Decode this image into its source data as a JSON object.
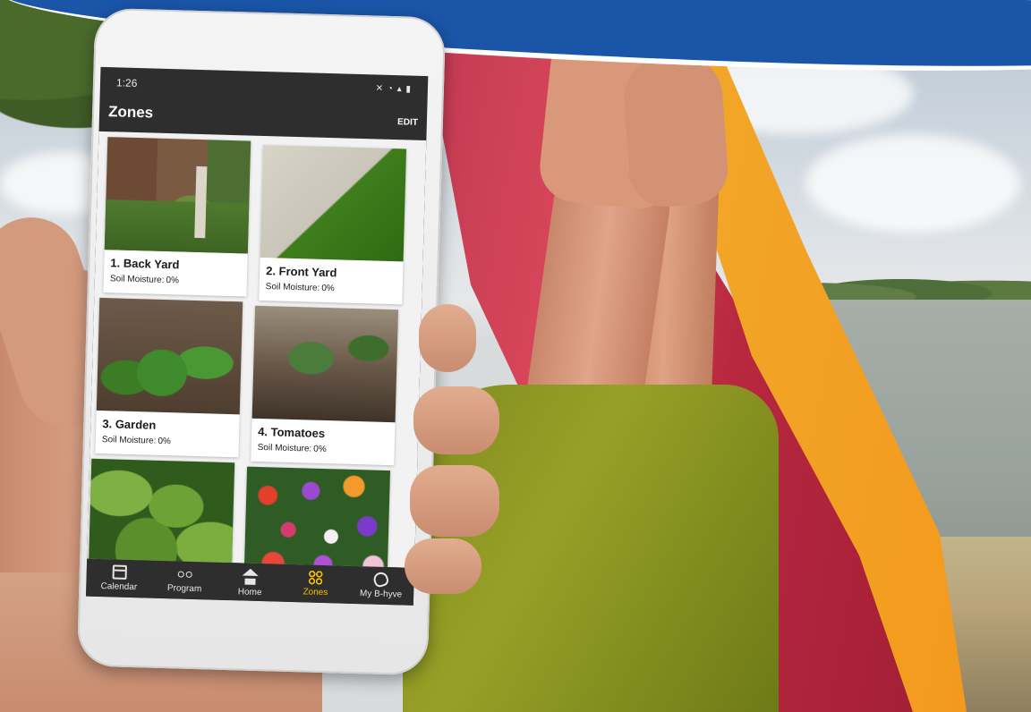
{
  "phone": {
    "status_time": "1:26",
    "status_icons": "✕ ◔ ▴ ▮",
    "app_title": "Zones",
    "edit_label": "EDIT"
  },
  "zones": [
    {
      "name": "1. Back Yard",
      "moisture_label": "Soil Moisture:",
      "moisture_value": "0%",
      "image": "back-yard-photo"
    },
    {
      "name": "2. Front Yard",
      "moisture_label": "Soil Moisture:",
      "moisture_value": "0%",
      "image": "front-yard-photo"
    },
    {
      "name": "3. Garden",
      "moisture_label": "Soil Moisture:",
      "moisture_value": "0%",
      "image": "garden-photo"
    },
    {
      "name": "4. Tomatoes",
      "moisture_label": "Soil Moisture:",
      "moisture_value": "0%",
      "image": "tomatoes-photo"
    },
    {
      "name": "",
      "moisture_label": "",
      "moisture_value": "",
      "image": "hosta-photo"
    },
    {
      "name": "",
      "moisture_label": "",
      "moisture_value": "",
      "image": "flowers-photo"
    }
  ],
  "bottom_nav": [
    {
      "label": "Calendar",
      "icon": "calendar-icon",
      "active": false
    },
    {
      "label": "Program",
      "icon": "program-icon",
      "active": false
    },
    {
      "label": "Home",
      "icon": "home-icon",
      "active": false
    },
    {
      "label": "Zones",
      "icon": "zones-icon",
      "active": true
    },
    {
      "label": "My B-hyve",
      "icon": "b-hyve-icon",
      "active": false
    }
  ],
  "colors": {
    "active_nav": "#f2c200",
    "app_bar": "#2e2e2e",
    "banner": "#1a55a8"
  }
}
